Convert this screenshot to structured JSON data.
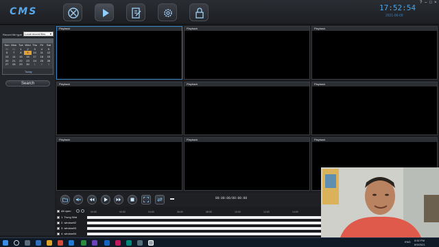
{
  "app": {
    "logo": "CMS",
    "clock": "17:52:54",
    "date": "2021-06-09",
    "window_controls": [
      "?",
      "–",
      "□",
      "×"
    ]
  },
  "nav": [
    {
      "name": "device-manager-icon",
      "active": false
    },
    {
      "name": "playback-icon",
      "active": true
    },
    {
      "name": "log-icon",
      "active": false
    },
    {
      "name": "settings-icon",
      "active": false
    },
    {
      "name": "lock-icon",
      "active": false
    }
  ],
  "left_panel": {
    "record_file_type_label": "Record file type",
    "record_file_type_value": "Local record files",
    "calendar": {
      "weekdays": [
        "Sun",
        "Mon",
        "Tue",
        "Wed",
        "Thu",
        "Fri",
        "Sat"
      ],
      "rows": [
        [
          "30",
          "31",
          "1",
          "2",
          "3",
          "4",
          "5"
        ],
        [
          "6",
          "7",
          "8",
          "9",
          "10",
          "11",
          "12"
        ],
        [
          "13",
          "14",
          "15",
          "16",
          "17",
          "18",
          "19"
        ],
        [
          "20",
          "21",
          "22",
          "23",
          "24",
          "25",
          "26"
        ],
        [
          "27",
          "28",
          "29",
          "30",
          "1",
          "2",
          "3"
        ]
      ],
      "selected_day": "9",
      "today_label": "Today"
    },
    "search_label": "Search"
  },
  "tiles": [
    {
      "label": "Playback",
      "selected": true
    },
    {
      "label": "Playback",
      "selected": false
    },
    {
      "label": "Playback",
      "selected": false
    },
    {
      "label": "Playback",
      "selected": false
    },
    {
      "label": "Playback",
      "selected": false
    },
    {
      "label": "Playback",
      "selected": false
    },
    {
      "label": "Playback",
      "selected": false
    },
    {
      "label": "Playback",
      "selected": false
    },
    {
      "label": "Playback",
      "selected": false
    }
  ],
  "toolbar": {
    "timecode": "00:00:00/00:00:00"
  },
  "timeline": {
    "all_open_label": "All open",
    "ticks": [
      "00:00",
      "02:00",
      "04:00",
      "06:00",
      "08:00",
      "10:00",
      "12:00",
      "14:00",
      "16:00"
    ],
    "channels": [
      "1. Trung Nhà",
      "2. window02",
      "3. window03",
      "4. window04"
    ]
  },
  "taskbar": {
    "lang": "ENG",
    "time": "5:52 PM",
    "date": "6/9/2021"
  },
  "colors": {
    "accent": "#49a6e8",
    "selected_day": "#e2a23a",
    "tile_selected_border": "#3a88c8"
  }
}
